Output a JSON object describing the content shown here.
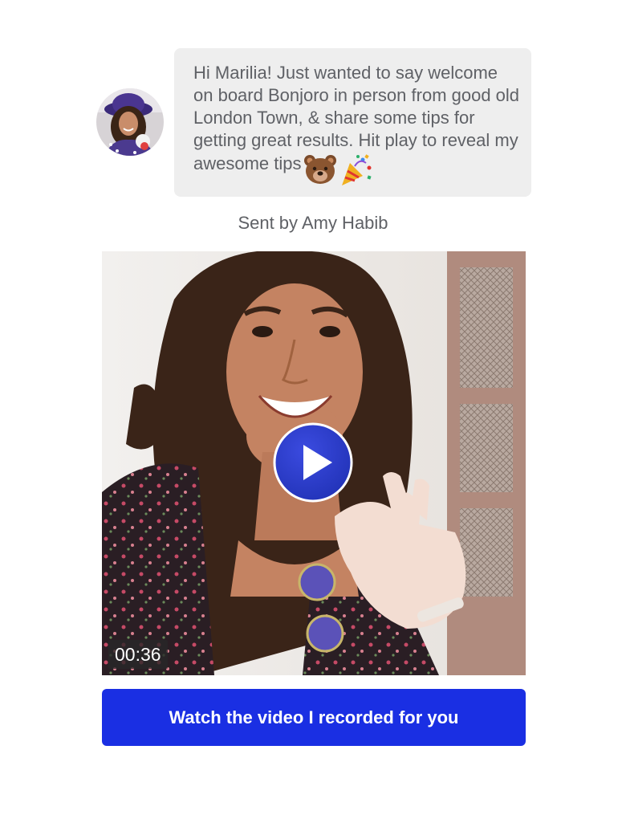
{
  "message": {
    "text": "Hi Marilia! Just wanted to say welcome on board Bonjoro in person from good old London Town, & share some tips for getting great results. Hit play to reveal my awesome tips",
    "emojis": [
      "bear-face-icon",
      "party-popper-icon"
    ]
  },
  "sender": {
    "label": "Sent by Amy Habib"
  },
  "video": {
    "duration": "00:36",
    "play_icon": "play-icon"
  },
  "cta": {
    "label": "Watch the video I recorded for you"
  },
  "colors": {
    "bubble_bg": "#eeeeee",
    "text": "#5f6166",
    "cta_bg": "#1a2fe3",
    "play_bg": "#2b3bc8"
  }
}
